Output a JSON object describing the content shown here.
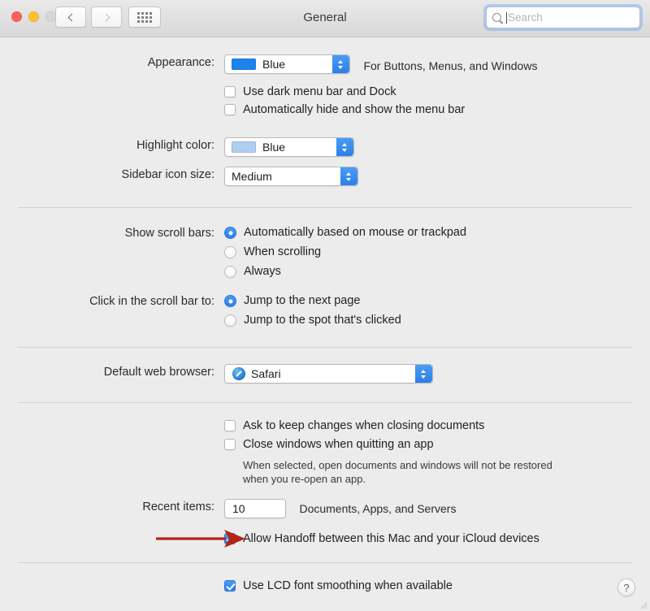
{
  "window": {
    "title": "General",
    "traffic_lights": [
      "close",
      "minimize",
      "zoom"
    ],
    "nav_back_icon": "chevron-left-icon",
    "nav_forward_icon": "chevron-right-icon",
    "show_all_icon": "grid-icon"
  },
  "search": {
    "placeholder": "Search",
    "value": "",
    "icon": "search-icon"
  },
  "appearance": {
    "label": "Appearance:",
    "value": "Blue",
    "swatch_color": "#1d83ec",
    "note": "For Buttons, Menus, and Windows",
    "dark_menubar": {
      "label": "Use dark menu bar and Dock",
      "checked": false
    },
    "auto_hide_menubar": {
      "label": "Automatically hide and show the menu bar",
      "checked": false
    }
  },
  "highlight": {
    "label": "Highlight color:",
    "value": "Blue",
    "swatch_color": "#aecdf0"
  },
  "sidebar_icon": {
    "label": "Sidebar icon size:",
    "value": "Medium"
  },
  "scrollbars": {
    "label": "Show scroll bars:",
    "options": [
      {
        "label": "Automatically based on mouse or trackpad",
        "selected": true
      },
      {
        "label": "When scrolling",
        "selected": false
      },
      {
        "label": "Always",
        "selected": false
      }
    ]
  },
  "scrollbar_click": {
    "label": "Click in the scroll bar to:",
    "options": [
      {
        "label": "Jump to the next page",
        "selected": true
      },
      {
        "label": "Jump to the spot that's clicked",
        "selected": false
      }
    ]
  },
  "browser": {
    "label": "Default web browser:",
    "value": "Safari",
    "icon": "safari-icon"
  },
  "documents": {
    "ask_keep_changes": {
      "label": "Ask to keep changes when closing documents",
      "checked": false
    },
    "close_windows": {
      "label": "Close windows when quitting an app",
      "checked": false
    },
    "note_line1": "When selected, open documents and windows will not be restored",
    "note_line2": "when you re-open an app."
  },
  "recent_items": {
    "label": "Recent items:",
    "value": "10",
    "note": "Documents, Apps, and Servers"
  },
  "handoff": {
    "label": "Allow Handoff between this Mac and your iCloud devices",
    "checked": true,
    "annotation_arrow_color": "#b52316"
  },
  "font_smoothing": {
    "label": "Use LCD font smoothing when available",
    "checked": true
  },
  "help": {
    "label": "?"
  }
}
